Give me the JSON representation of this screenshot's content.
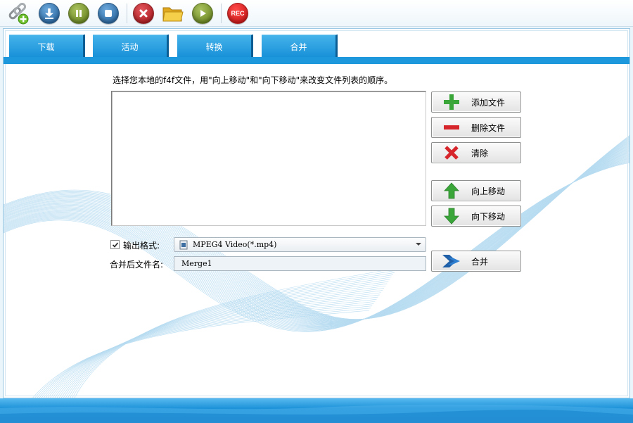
{
  "toolbar": {
    "buttons": [
      {
        "name": "add-link",
        "icon": "link-add-icon"
      },
      {
        "name": "download",
        "icon": "download-icon"
      },
      {
        "name": "pause",
        "icon": "pause-icon"
      },
      {
        "name": "stop",
        "icon": "stop-icon"
      },
      {
        "name": "delete",
        "icon": "close-icon"
      },
      {
        "name": "open-folder",
        "icon": "folder-icon"
      },
      {
        "name": "play",
        "icon": "play-icon"
      },
      {
        "name": "record",
        "icon": "record-icon",
        "label": "REC"
      }
    ]
  },
  "tabs": [
    {
      "label": "下载"
    },
    {
      "label": "活动"
    },
    {
      "label": "转换"
    },
    {
      "label": "合并"
    }
  ],
  "merge": {
    "instruction": "选择您本地的f4f文件，用\"向上移动\"和\"向下移动\"来改变文件列表的顺序。",
    "buttons": {
      "add": "添加文件",
      "remove": "删除文件",
      "clear": "清除",
      "up": "向上移动",
      "down": "向下移动",
      "merge": "合并"
    },
    "output_format_label": "输出格式:",
    "output_format_checked": true,
    "output_format_value": "MPEG4 Video(*.mp4)",
    "filename_label": "合并后文件名:",
    "filename_value": "Merge1"
  },
  "colors": {
    "tab_blue": "#1790d8",
    "accent_green": "#3aa63a",
    "accent_red": "#d6262b",
    "arrow_blue": "#1f5fa8"
  }
}
